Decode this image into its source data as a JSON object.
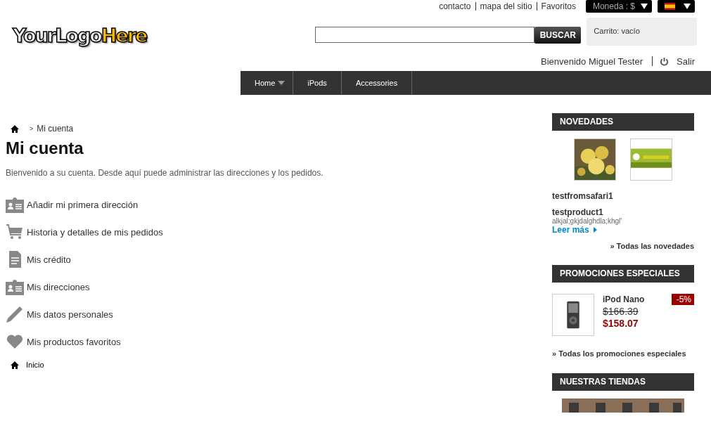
{
  "header": {
    "top_links": [
      "contacto",
      "mapa del sitio",
      "Favoritos"
    ],
    "currency": "Moneda : $",
    "logo": {
      "part_1": "YourLogo",
      "part_2": "Here"
    },
    "search": {
      "button": "BUSCAR"
    },
    "cart": "Carrito: vacío",
    "welcome": "Bienvenido Miguel Tester",
    "logout": "Salir"
  },
  "nav": [
    {
      "label": "Home",
      "has_menu": true
    },
    {
      "label": "iPods",
      "has_menu": false
    },
    {
      "label": "Accessories",
      "has_menu": false
    }
  ],
  "breadcrumb_separator": ">",
  "breadcrumb": "Mi cuenta",
  "title": "Mi cuenta",
  "intro": "Bienvenido a su cuenta. Desde aquí puede administrar las direcciones y los pedidos.",
  "account_links": [
    "Añadir mi primera dirección",
    "Historia y detalles de mis pedidos",
    "Mis crédito",
    "Mis direcciones",
    "Mis datos personales",
    "Mis productos favoritos"
  ],
  "footer_link": "Inicio",
  "new_products": {
    "title": "NOVEDADES",
    "items": [
      {
        "name": "testfromsafari1"
      },
      {
        "name": "testproduct1",
        "description": "alkjal;gkjdalghdla;khgl'",
        "read_more": "Leer más"
      }
    ],
    "all_link": "» Todas las novedades"
  },
  "specials": {
    "title": "PROMOCIONES ESPECIALES",
    "product": {
      "name": "iPod Nano",
      "old_price": "$166.39",
      "price": "$158.07",
      "discount": "-5%"
    },
    "all_link": "» Todas los promociones especiales"
  },
  "stores": {
    "title": "NUESTRAS TIENDAS"
  }
}
